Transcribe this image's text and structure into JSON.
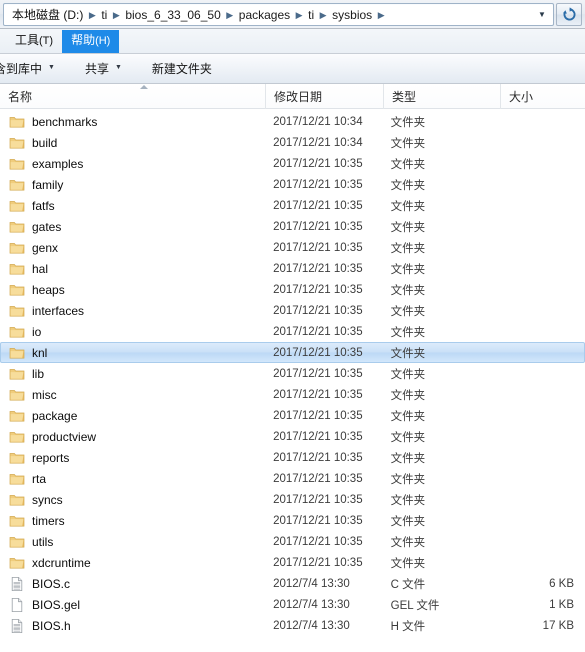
{
  "address": {
    "crumbs": [
      "本地磁盘 (D:)",
      "ti",
      "bios_6_33_06_50",
      "packages",
      "ti",
      "sysbios"
    ],
    "separator": "▶",
    "dropdown_icon": "chevron-down-icon",
    "refresh_icon": "refresh-icon"
  },
  "menubar": {
    "items": [
      {
        "label": "工具",
        "mnemonic": "(T)",
        "selected": false
      },
      {
        "label": "帮助",
        "mnemonic": "(H)",
        "selected": true
      }
    ]
  },
  "toolbar": {
    "items": [
      {
        "label": "含到库中",
        "caret": true,
        "clipped": true
      },
      {
        "label": "共享",
        "caret": true,
        "clipped": false
      },
      {
        "label": "新建文件夹",
        "caret": false,
        "clipped": false
      }
    ],
    "caret_glyph": "▼"
  },
  "columns": {
    "name": "名称",
    "date": "修改日期",
    "type": "类型",
    "size": "大小",
    "sort": "ascending"
  },
  "colors": {
    "selection": "#c9e0f7",
    "selection_border": "#a9ccec",
    "menu_highlight": "#1e8ae8",
    "folder_icon": "#f6d98a",
    "folder_icon_dark": "#e3b95a"
  },
  "files": [
    {
      "name": "benchmarks",
      "date": "2017/12/21 10:34",
      "type": "文件夹",
      "size": "",
      "icon": "folder-icon",
      "selected": false
    },
    {
      "name": "build",
      "date": "2017/12/21 10:34",
      "type": "文件夹",
      "size": "",
      "icon": "folder-icon",
      "selected": false
    },
    {
      "name": "examples",
      "date": "2017/12/21 10:35",
      "type": "文件夹",
      "size": "",
      "icon": "folder-icon",
      "selected": false
    },
    {
      "name": "family",
      "date": "2017/12/21 10:35",
      "type": "文件夹",
      "size": "",
      "icon": "folder-icon",
      "selected": false
    },
    {
      "name": "fatfs",
      "date": "2017/12/21 10:35",
      "type": "文件夹",
      "size": "",
      "icon": "folder-icon",
      "selected": false
    },
    {
      "name": "gates",
      "date": "2017/12/21 10:35",
      "type": "文件夹",
      "size": "",
      "icon": "folder-icon",
      "selected": false
    },
    {
      "name": "genx",
      "date": "2017/12/21 10:35",
      "type": "文件夹",
      "size": "",
      "icon": "folder-icon",
      "selected": false
    },
    {
      "name": "hal",
      "date": "2017/12/21 10:35",
      "type": "文件夹",
      "size": "",
      "icon": "folder-icon",
      "selected": false
    },
    {
      "name": "heaps",
      "date": "2017/12/21 10:35",
      "type": "文件夹",
      "size": "",
      "icon": "folder-icon",
      "selected": false
    },
    {
      "name": "interfaces",
      "date": "2017/12/21 10:35",
      "type": "文件夹",
      "size": "",
      "icon": "folder-icon",
      "selected": false
    },
    {
      "name": "io",
      "date": "2017/12/21 10:35",
      "type": "文件夹",
      "size": "",
      "icon": "folder-icon",
      "selected": false
    },
    {
      "name": "knl",
      "date": "2017/12/21 10:35",
      "type": "文件夹",
      "size": "",
      "icon": "folder-icon",
      "selected": true
    },
    {
      "name": "lib",
      "date": "2017/12/21 10:35",
      "type": "文件夹",
      "size": "",
      "icon": "folder-icon",
      "selected": false
    },
    {
      "name": "misc",
      "date": "2017/12/21 10:35",
      "type": "文件夹",
      "size": "",
      "icon": "folder-icon",
      "selected": false
    },
    {
      "name": "package",
      "date": "2017/12/21 10:35",
      "type": "文件夹",
      "size": "",
      "icon": "folder-icon",
      "selected": false
    },
    {
      "name": "productview",
      "date": "2017/12/21 10:35",
      "type": "文件夹",
      "size": "",
      "icon": "folder-icon",
      "selected": false
    },
    {
      "name": "reports",
      "date": "2017/12/21 10:35",
      "type": "文件夹",
      "size": "",
      "icon": "folder-icon",
      "selected": false
    },
    {
      "name": "rta",
      "date": "2017/12/21 10:35",
      "type": "文件夹",
      "size": "",
      "icon": "folder-icon",
      "selected": false
    },
    {
      "name": "syncs",
      "date": "2017/12/21 10:35",
      "type": "文件夹",
      "size": "",
      "icon": "folder-icon",
      "selected": false
    },
    {
      "name": "timers",
      "date": "2017/12/21 10:35",
      "type": "文件夹",
      "size": "",
      "icon": "folder-icon",
      "selected": false
    },
    {
      "name": "utils",
      "date": "2017/12/21 10:35",
      "type": "文件夹",
      "size": "",
      "icon": "folder-icon",
      "selected": false
    },
    {
      "name": "xdcruntime",
      "date": "2017/12/21 10:35",
      "type": "文件夹",
      "size": "",
      "icon": "folder-icon",
      "selected": false
    },
    {
      "name": "BIOS.c",
      "date": "2012/7/4 13:30",
      "type": "C 文件",
      "size": "6 KB",
      "icon": "text-document-icon",
      "selected": false
    },
    {
      "name": "BIOS.gel",
      "date": "2012/7/4 13:30",
      "type": "GEL 文件",
      "size": "1 KB",
      "icon": "blank-document-icon",
      "selected": false
    },
    {
      "name": "BIOS.h",
      "date": "2012/7/4 13:30",
      "type": "H 文件",
      "size": "17 KB",
      "icon": "text-document-icon",
      "selected": false
    }
  ]
}
